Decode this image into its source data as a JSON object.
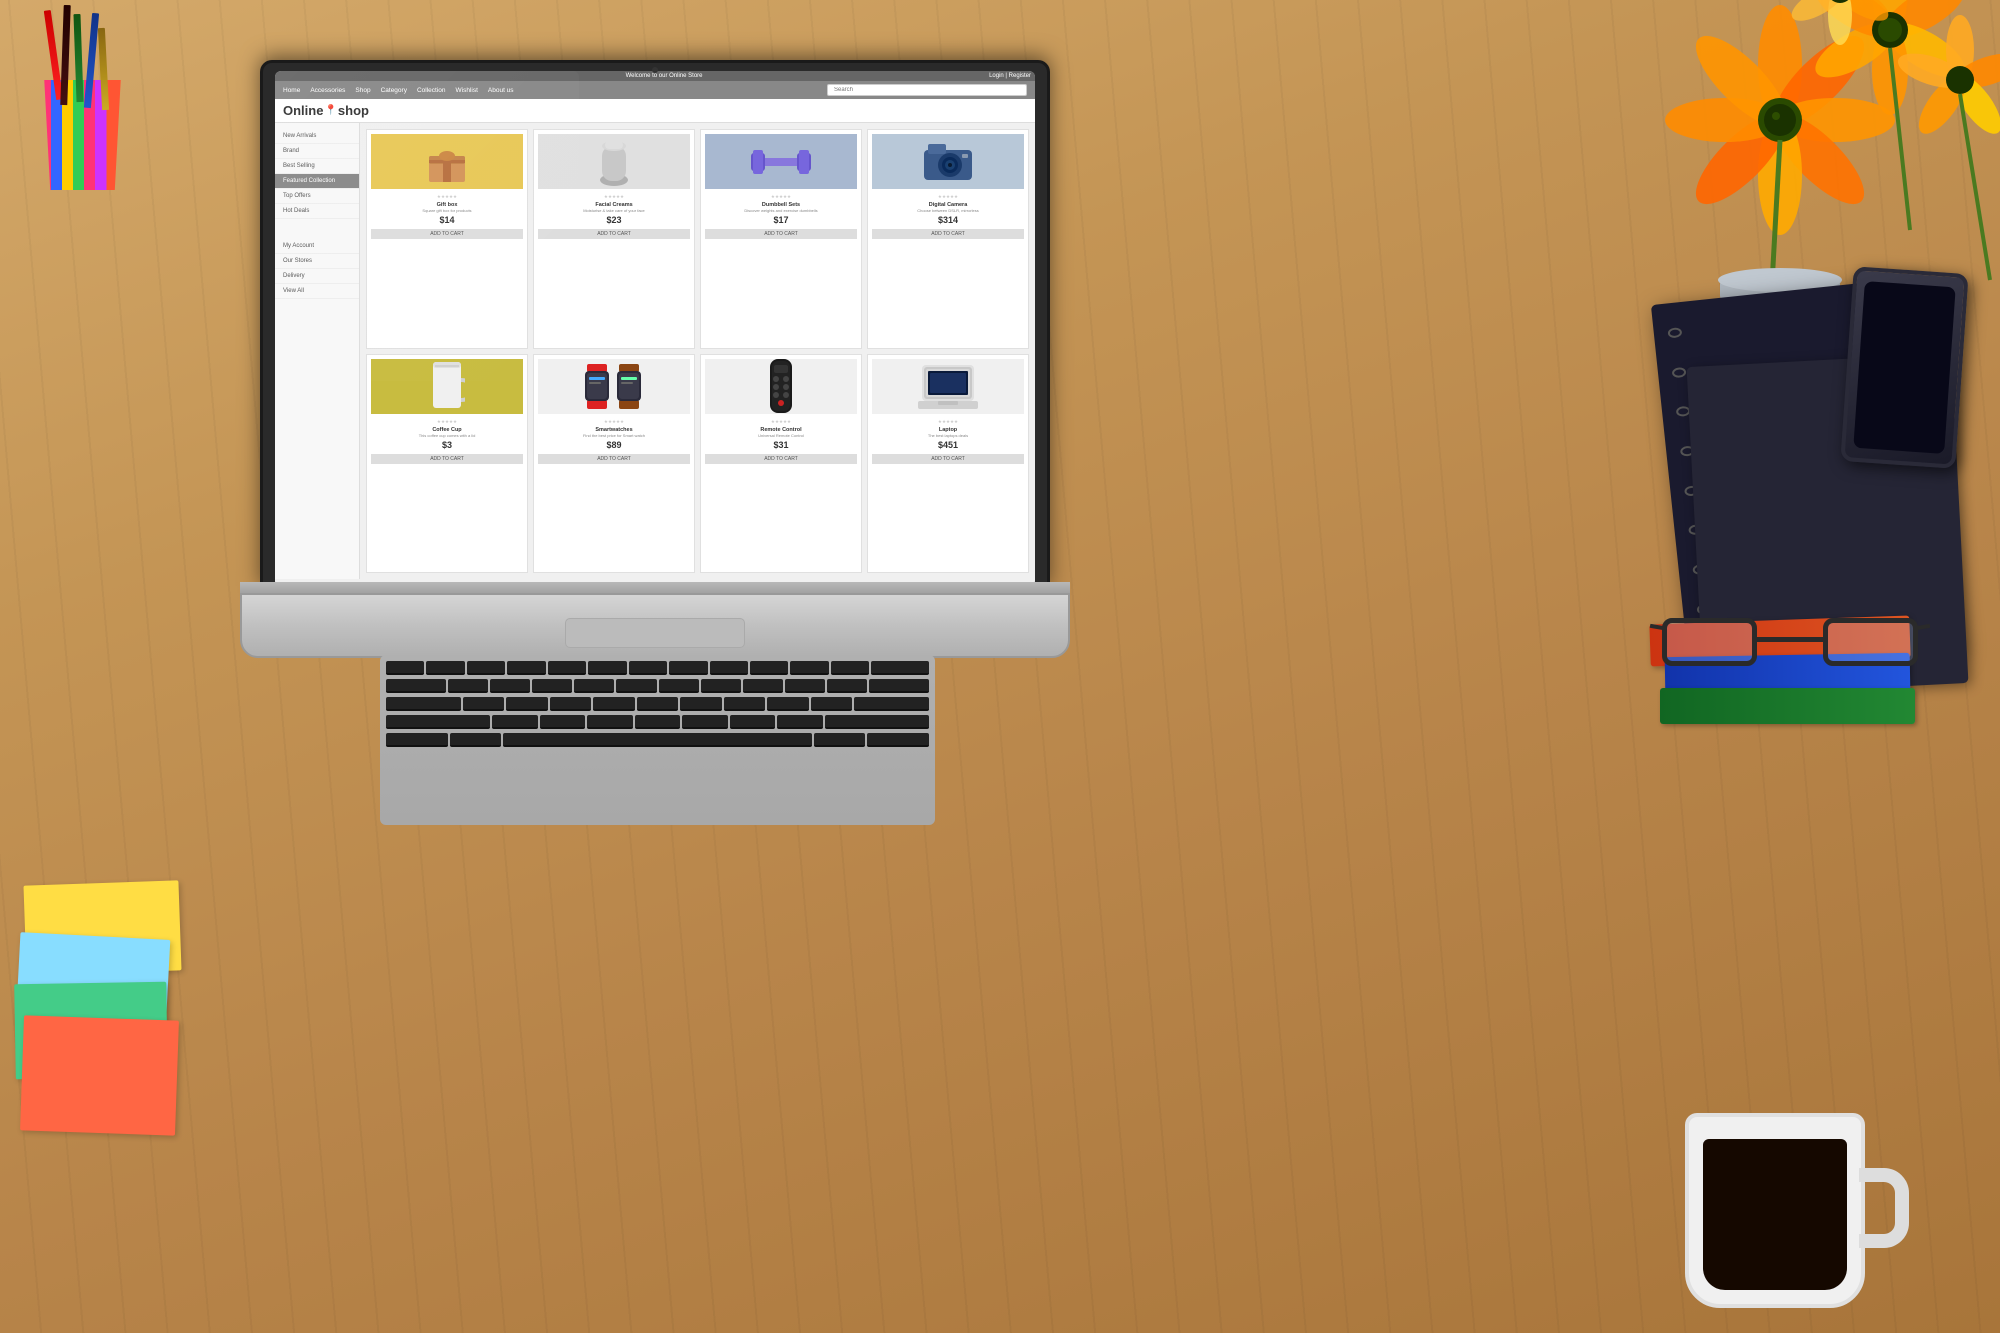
{
  "scene": {
    "desk_bg": "wooden desk"
  },
  "store": {
    "banner": {
      "welcome_text": "Welcome to our Online Store",
      "login_register": "Login | Register"
    },
    "nav": {
      "items": [
        "Home",
        "Accessories",
        "Shop",
        "Category",
        "Collection",
        "Wishlist",
        "About us"
      ]
    },
    "search": {
      "placeholder": "Search"
    },
    "logo": {
      "text": "Online",
      "text2": "shop",
      "pin": "📍"
    },
    "main_nav": {
      "items": [
        "Home",
        "Accessories",
        "Shop",
        "Category",
        "Collection",
        "Wishlist",
        "About us"
      ]
    },
    "sidebar": {
      "items": [
        {
          "label": "New Arrivals",
          "active": false
        },
        {
          "label": "Brand",
          "active": false
        },
        {
          "label": "Best Selling",
          "active": false
        },
        {
          "label": "Featured Collection",
          "active": true
        },
        {
          "label": "Top Offers",
          "active": false
        },
        {
          "label": "Hot Deals",
          "active": false
        },
        {
          "label": "My Account",
          "active": false
        },
        {
          "label": "Our Stores",
          "active": false
        },
        {
          "label": "Delivery",
          "active": false
        },
        {
          "label": "View All",
          "active": false
        }
      ]
    },
    "products": [
      {
        "name": "Gift box",
        "desc": "Square gift box for products",
        "price": "$14",
        "bg": "yellow",
        "stars": "★★★★★",
        "add_cart": "ADD TO CART"
      },
      {
        "name": "Facial Creams",
        "desc": "Moisturise & take care of your face",
        "price": "$23",
        "bg": "gray",
        "stars": "★★★★★",
        "add_cart": "ADD TO CART"
      },
      {
        "name": "Dumbbell Sets",
        "desc": "Discover weights and exercise dumbbells",
        "price": "$17",
        "bg": "blue",
        "stars": "★★★★★",
        "add_cart": "ADD TO CART"
      },
      {
        "name": "Digital Camera",
        "desc": "Choose between DSLR, mirrorless",
        "price": "$314",
        "bg": "white",
        "stars": "★★★★★",
        "add_cart": "ADD TO CART"
      },
      {
        "name": "Coffee Cup",
        "desc": "This coffee cup comes with a lid",
        "price": "$3",
        "bg": "yellow2",
        "stars": "★★★★★",
        "add_cart": "ADD TO CART"
      },
      {
        "name": "Smartwatches",
        "desc": "Find the best price for Smart watch",
        "price": "$89",
        "bg": "white",
        "stars": "★★★★★",
        "add_cart": "ADD TO CART"
      },
      {
        "name": "Remote Control",
        "desc": "Universal Remote Control",
        "price": "$31",
        "bg": "white",
        "stars": "★★★★★",
        "add_cart": "ADD TO CART"
      },
      {
        "name": "Laptop",
        "desc": "The best laptops deals",
        "price": "$451",
        "bg": "white",
        "stars": "★★★★★",
        "add_cart": "ADD TO CART"
      }
    ]
  }
}
